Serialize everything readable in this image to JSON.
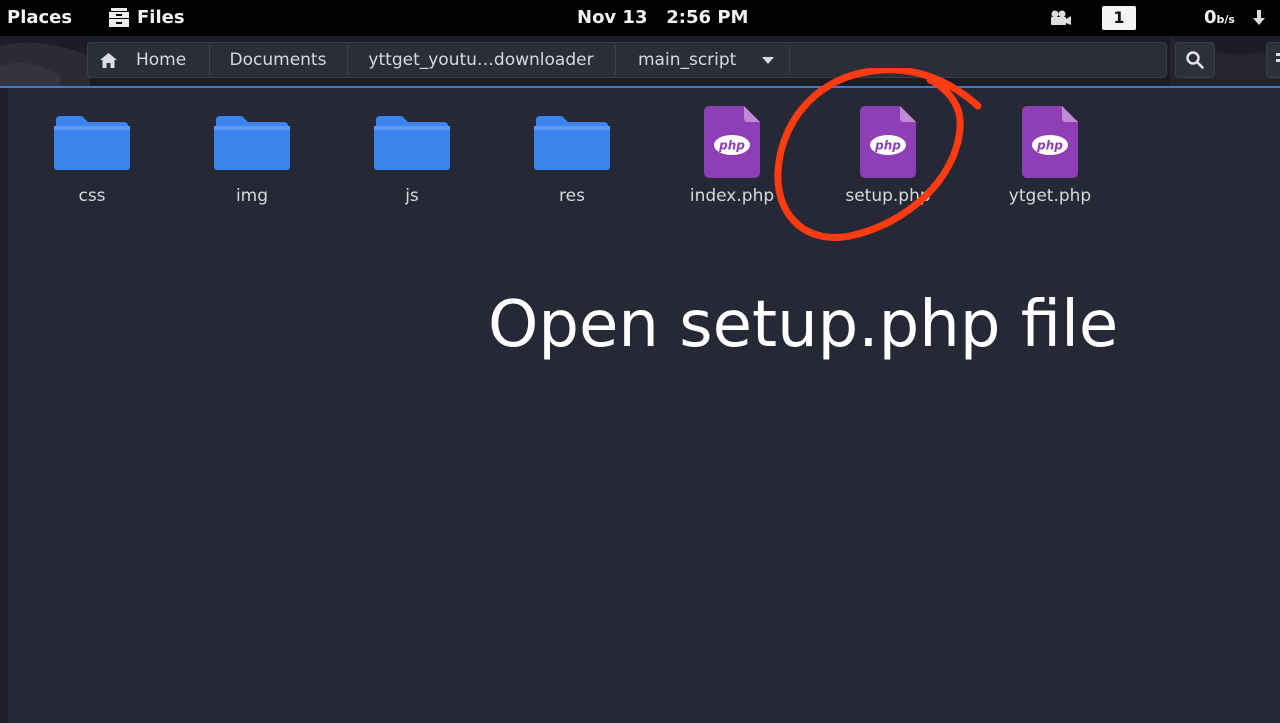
{
  "topbar": {
    "places_label": "Places",
    "app_label": "Files",
    "clock": "Nov 13   2:56 PM",
    "workspace_number": "1",
    "net_speed_value": "0",
    "net_speed_unit": "b/s"
  },
  "pathbar": {
    "crumbs": [
      "Home",
      "Documents",
      "yttget_youtu…downloader",
      "main_script"
    ]
  },
  "files": [
    {
      "name": "css",
      "type": "folder",
      "icon": "folder-icon"
    },
    {
      "name": "img",
      "type": "folder",
      "icon": "folder-icon"
    },
    {
      "name": "js",
      "type": "folder",
      "icon": "folder-icon"
    },
    {
      "name": "res",
      "type": "folder",
      "icon": "folder-icon"
    },
    {
      "name": "index.php",
      "type": "php",
      "icon": "php-file-icon"
    },
    {
      "name": "setup.php",
      "type": "php",
      "icon": "php-file-icon"
    },
    {
      "name": "ytget.php",
      "type": "php",
      "icon": "php-file-icon"
    }
  ],
  "php_icon_text": "php",
  "caption": "Open setup.php file",
  "colors": {
    "folder": "#3d84ec",
    "php_file": "#8e3fb6",
    "accent": "#3a79d2",
    "annotation": "#ff3b12",
    "background": "#262835"
  }
}
